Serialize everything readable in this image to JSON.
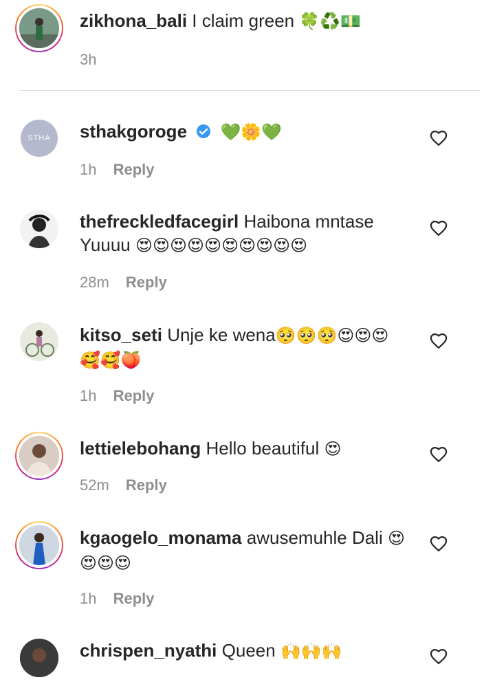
{
  "comments": [
    {
      "username": "zikhona_bali",
      "text": "I claim green",
      "emoji": "🍀♻️💵",
      "time": "3h",
      "reply": ""
    },
    {
      "username": "sthakgoroge",
      "text": "",
      "emoji": "💚🌼💚",
      "time": "1h",
      "reply": "Reply",
      "avatar_text": "STHA"
    },
    {
      "username": "thefreckledfacegirl",
      "text": "Haibona mntase",
      "text2": "Yuuuu",
      "emoji": "😍😍😍😍😍😍😍😍😍😍",
      "time": "28m",
      "reply": "Reply"
    },
    {
      "username": "kitso_seti",
      "text": "Unje ke wena",
      "emoji": "🥺🥺🥺😍😍😍",
      "emoji2": "🥰🥰🍑",
      "time": "1h",
      "reply": "Reply"
    },
    {
      "username": "lettielebohang",
      "text": "Hello beautiful",
      "emoji": "😍",
      "time": "52m",
      "reply": "Reply"
    },
    {
      "username": "kgaogelo_monama",
      "text": "awusemuhle Dali",
      "emoji": "😍",
      "emoji2": "😍😍😍",
      "time": "1h",
      "reply": "Reply"
    },
    {
      "username": "chrispen_nyathi",
      "text": "Queen",
      "emoji": "🙌🙌🙌"
    }
  ]
}
